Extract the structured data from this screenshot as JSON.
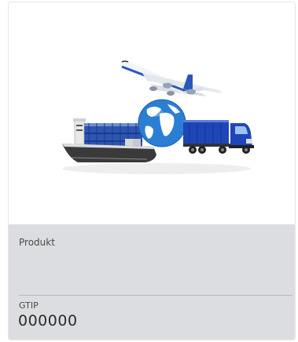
{
  "card": {
    "image_icon": "logistics-transport-icon",
    "product_label": "Produkt",
    "gtip_label": "GTIP",
    "gtip_value": "000000"
  },
  "colors": {
    "info_background": "#dcdde0",
    "divider": "#b7b9bd",
    "globe_blue": "#2a7fd4",
    "truck_blue": "#1f46b8",
    "ship_hull": "#3a3a3a"
  }
}
